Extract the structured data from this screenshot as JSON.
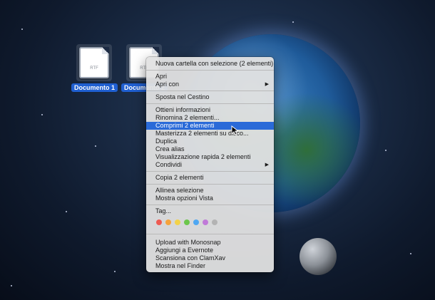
{
  "desktop": {
    "icons": [
      {
        "label": "Documento 1",
        "ext": "RTF"
      },
      {
        "label": "Documento 2",
        "ext": "RTF"
      }
    ]
  },
  "menu": {
    "header": "Nuova cartella con selezione (2 elementi)",
    "group1": [
      "Apri",
      "Apri con"
    ],
    "trash": "Sposta nel Cestino",
    "group3": [
      "Ottieni informazioni",
      "Rinomina 2 elementi...",
      "Comprimi 2 elementi",
      "Masterizza 2 elementi su disco...",
      "Duplica",
      "Crea alias",
      "Visualizzazione rapida 2 elementi",
      "Condividi"
    ],
    "copy": "Copia 2 elementi",
    "view": [
      "Allinea selezione",
      "Mostra opzioni Vista"
    ],
    "tags_label": "Tag...",
    "tag_colors": [
      "#ee5a52",
      "#f5a33c",
      "#f3d24a",
      "#6cc64c",
      "#4fa7f2",
      "#c07ad8",
      "#b3b3b3"
    ],
    "services": [
      "Upload with Monosnap",
      "Aggiungi a Evernote",
      "Scansiona con ClamXav",
      "Mostra nel Finder"
    ],
    "highlighted": "Comprimi 2 elementi"
  }
}
